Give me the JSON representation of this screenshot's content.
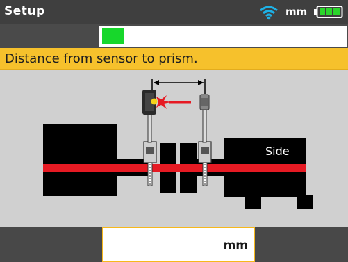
{
  "header": {
    "title": "Setup",
    "unit": "mm",
    "icons": [
      "wifi-icon",
      "battery-icon"
    ],
    "battery_color": "#2bd62b"
  },
  "progress": {
    "fraction": 0.09,
    "color": "#17d72b"
  },
  "instruction": {
    "text": "Distance from sensor to prism.",
    "bg": "#f6c12c"
  },
  "diagram": {
    "side_label": "Side",
    "beam_color": "#e61a23"
  },
  "input": {
    "unit": "mm",
    "value": ""
  }
}
